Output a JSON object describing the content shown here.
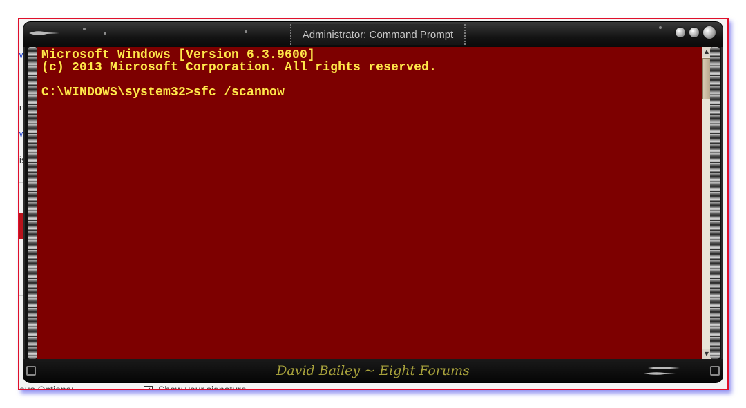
{
  "window": {
    "title": "Administrator: Command Prompt",
    "signature": "David Bailey ~ Eight Forums"
  },
  "console": {
    "lines": [
      "Microsoft Windows [Version 6.3.9600]",
      "(c) 2013 Microsoft Corporation. All rights reserved.",
      "",
      "C:\\WINDOWS\\system32>sfc /scannow"
    ]
  },
  "background_page": {
    "fragment_1": "n",
    "fragment_2": "w",
    "fragment_3": "is",
    "options_label": "ous Options:",
    "signature_checkbox_label": "Show your signature",
    "signature_checkbox_checked": true
  },
  "colors": {
    "console_bg": "#7d0000",
    "console_text": "#ffe84a",
    "screenshot_border": "#e0102a"
  },
  "icons": {
    "minimize": "minimize-icon",
    "maximize": "maximize-icon",
    "close": "close-icon",
    "scroll_up": "scroll-up-arrow-icon",
    "scroll_down": "scroll-down-arrow-icon"
  }
}
